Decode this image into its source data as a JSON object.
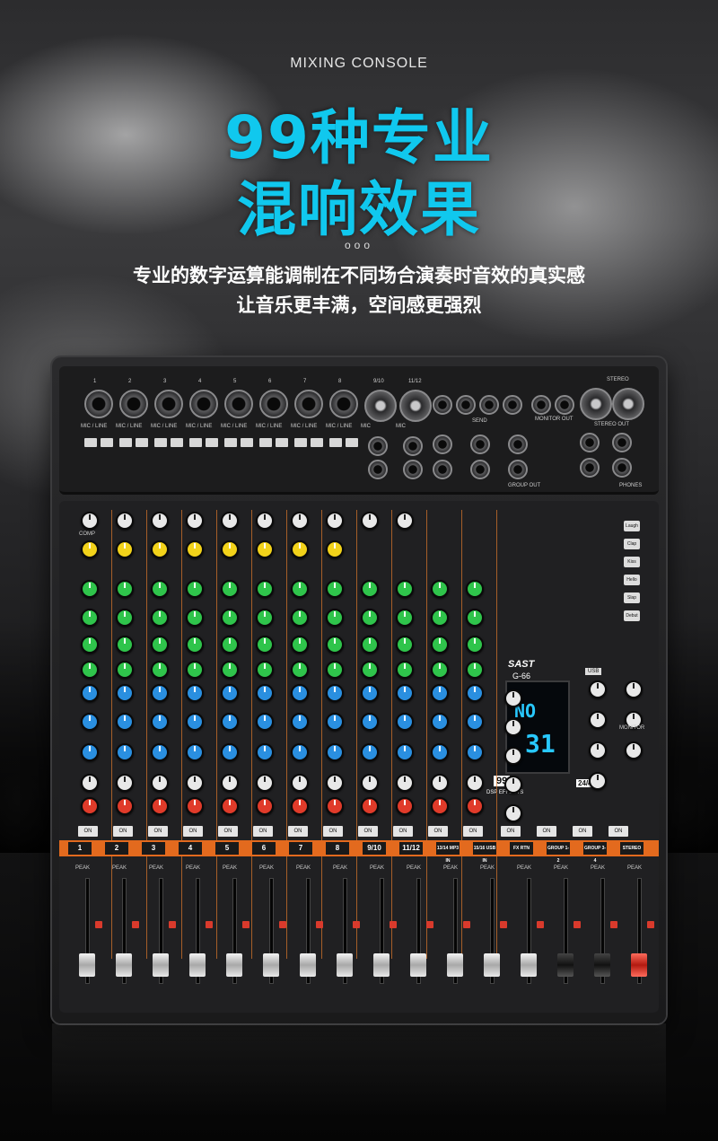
{
  "header": {
    "eyebrow": "MIXING CONSOLE",
    "title_line1": "99种专业",
    "title_line2": "混响效果",
    "dots": "ooo",
    "subtitle_line1": "专业的数字运算能调制在不同场合演奏时音效的真实感",
    "subtitle_line2": "让音乐更丰满，空间感更强烈"
  },
  "colors": {
    "title": "#10c8ee",
    "accent": "#e36a1e",
    "display": "#28c8ff"
  },
  "mixer": {
    "brand": "SAST",
    "model": "G-66",
    "usb_label": "USB",
    "display_line1": "NO",
    "display_line2": "31",
    "effects_badge": "99",
    "effects_label": "DSP EFFECTS",
    "bitrate_badge": "24/48",
    "input_labels": [
      "MIC / LINE",
      "MIC / LINE",
      "MIC / LINE",
      "MIC / LINE",
      "MIC / LINE",
      "MIC / LINE",
      "MIC / LINE",
      "MIC / LINE",
      "MIC",
      "MIC"
    ],
    "input_numbers": [
      "1",
      "2",
      "3",
      "4",
      "5",
      "6",
      "7",
      "8",
      "9/10",
      "11/12"
    ],
    "stereo_label": "STEREO",
    "stereo_out_label": "STEREO OUT",
    "monitor_out_label": "MONITOR OUT",
    "group_out_label": "GROUP OUT",
    "phones_label": "PHONES",
    "send_label": "SEND",
    "comp_label": "COMP",
    "on_label": "ON",
    "channel_strip": [
      "1",
      "2",
      "3",
      "4",
      "5",
      "6",
      "7",
      "8",
      "9/10",
      "11/12",
      "13/14 MP3 IN",
      "15/16 USB IN",
      "FX RTN",
      "GROUP 1-2",
      "GROUP 3-4",
      "STEREO"
    ],
    "effect_buttons": [
      "Laugh",
      "Clap",
      "Kiss",
      "Hello",
      "Slap",
      "Debut"
    ],
    "monitor_label": "MONITOR",
    "peak_label": "PEAK"
  }
}
